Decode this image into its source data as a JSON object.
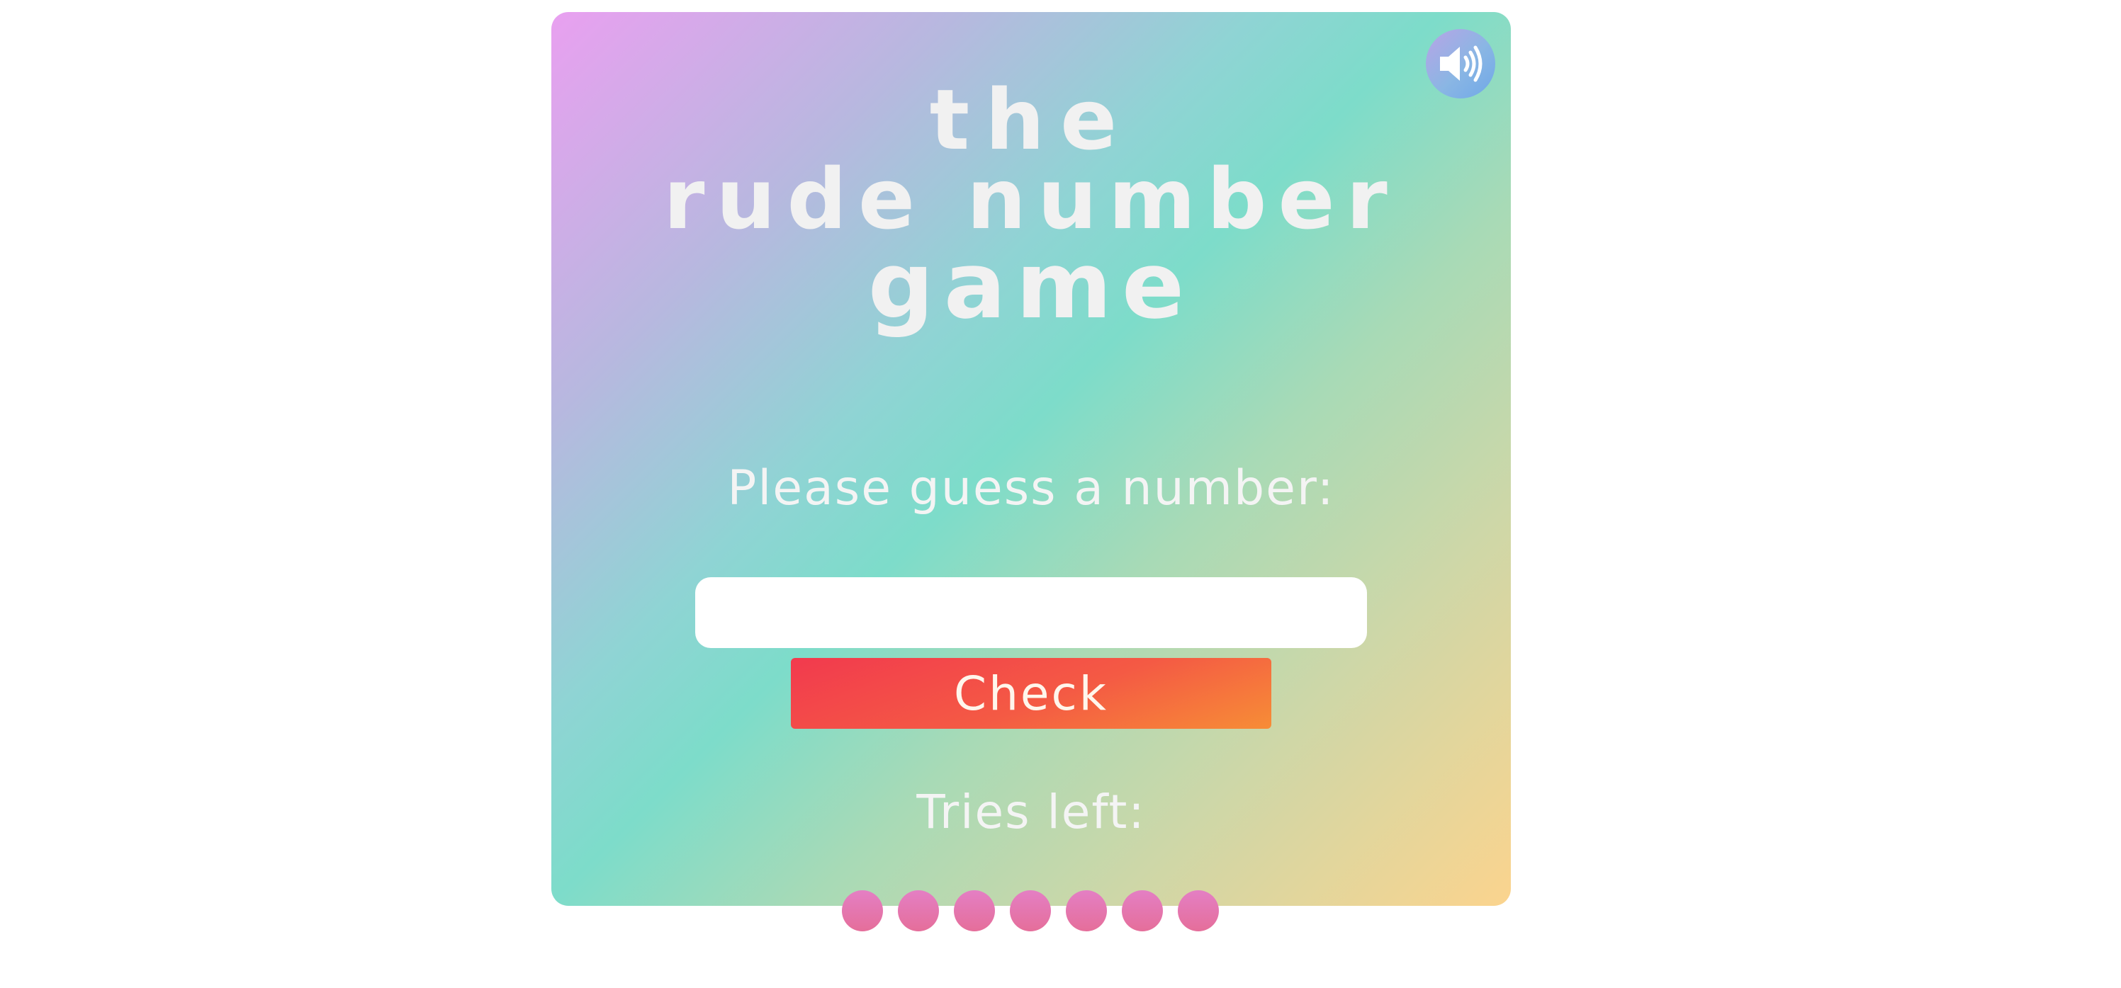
{
  "title": {
    "line1": "the",
    "line2": "rude number",
    "line3": "game"
  },
  "prompt": "Please guess a number:",
  "guess_input": {
    "value": "",
    "placeholder": ""
  },
  "check_button_label": "Check",
  "tries_label": "Tries left:",
  "tries_remaining": 7,
  "icons": {
    "sound": "speaker-icon"
  },
  "colors": {
    "card_gradient": [
      "#e9a0f0",
      "#7ddcca",
      "#fbd48e"
    ],
    "check_button": [
      "#f23a4e",
      "#f78d36"
    ],
    "try_dot": "#e47fc4",
    "title_text": "#f1f1f1"
  }
}
